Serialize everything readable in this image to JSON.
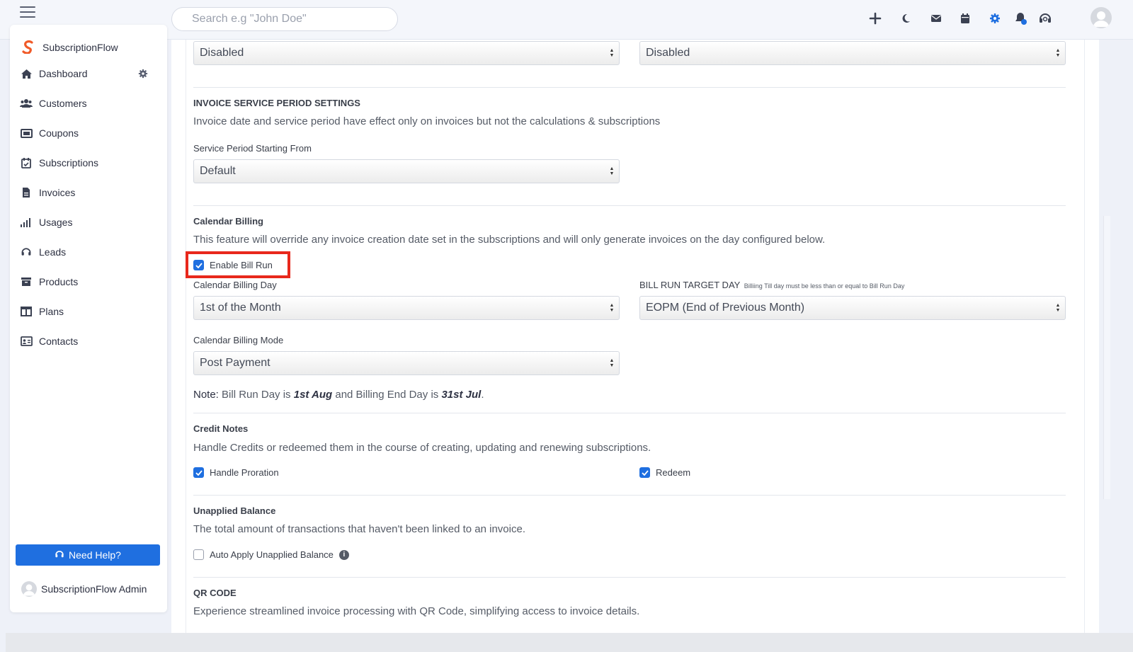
{
  "topbar": {
    "search_placeholder": "Search e.g \"John Doe\"",
    "icons": [
      "plus-icon",
      "moon-icon",
      "mail-icon",
      "calendar-icon",
      "gear-icon",
      "bell-icon",
      "headset-icon",
      "user-avatar"
    ]
  },
  "sidebar": {
    "brand": "SubscriptionFlow",
    "items": [
      {
        "label": "Dashboard",
        "icon": "home-icon"
      },
      {
        "label": "Customers",
        "icon": "users-icon"
      },
      {
        "label": "Coupons",
        "icon": "ticket-icon"
      },
      {
        "label": "Subscriptions",
        "icon": "calendar-check-icon"
      },
      {
        "label": "Invoices",
        "icon": "file-invoice-icon"
      },
      {
        "label": "Usages",
        "icon": "signal-icon"
      },
      {
        "label": "Leads",
        "icon": "headset-icon"
      },
      {
        "label": "Products",
        "icon": "archive-icon"
      },
      {
        "label": "Plans",
        "icon": "columns-icon"
      },
      {
        "label": "Contacts",
        "icon": "id-card-icon"
      }
    ],
    "help_label": "Need Help?",
    "admin_name": "SubscriptionFlow Admin"
  },
  "main": {
    "top_select_left": "Disabled",
    "top_select_right": "Disabled",
    "invoice_service": {
      "title": "INVOICE SERVICE PERIOD SETTINGS",
      "description": "Invoice date and service period have effect only on invoices but not the calculations & subscriptions",
      "service_label": "Service Period Starting From",
      "service_value": "Default"
    },
    "calendar_billing": {
      "title": "Calendar Billing",
      "description": "This feature will override any invoice creation date set in the subscriptions and will only generate invoices on the day configured below.",
      "enable_label": "Enable Bill Run",
      "enable_checked": true,
      "day_label": "Calendar Billing Day",
      "day_value": "1st of the Month",
      "target_label": "BILL RUN TARGET DAY",
      "target_hint": "Billiing Till day must be less than or equal to Bill Run Day",
      "target_value": "EOPM (End of Previous Month)",
      "mode_label": "Calendar Billing Mode",
      "mode_value": "Post Payment",
      "note_prefix": "Note:",
      "note_text1": "Bill Run Day is",
      "note_date1": "1st Aug",
      "note_text2": "and Billing End Day is",
      "note_date2": "31st Jul",
      "note_end": "."
    },
    "credit_notes": {
      "title": "Credit Notes",
      "description": "Handle Credits or redeemed them in the course of creating, updating and renewing subscriptions.",
      "proration_label": "Handle Proration",
      "redeem_label": "Redeem"
    },
    "unapplied": {
      "title": "Unapplied Balance",
      "description": "The total amount of transactions that haven't been linked to an invoice.",
      "auto_label": "Auto Apply Unapplied Balance"
    },
    "qr": {
      "title": "QR CODE",
      "description": "Experience streamlined invoice processing with QR Code, simplifying access to invoice details."
    }
  },
  "colors": {
    "accent": "#1f6fe0",
    "highlight": "#e8281c",
    "brand_orange": "#f05a28"
  }
}
